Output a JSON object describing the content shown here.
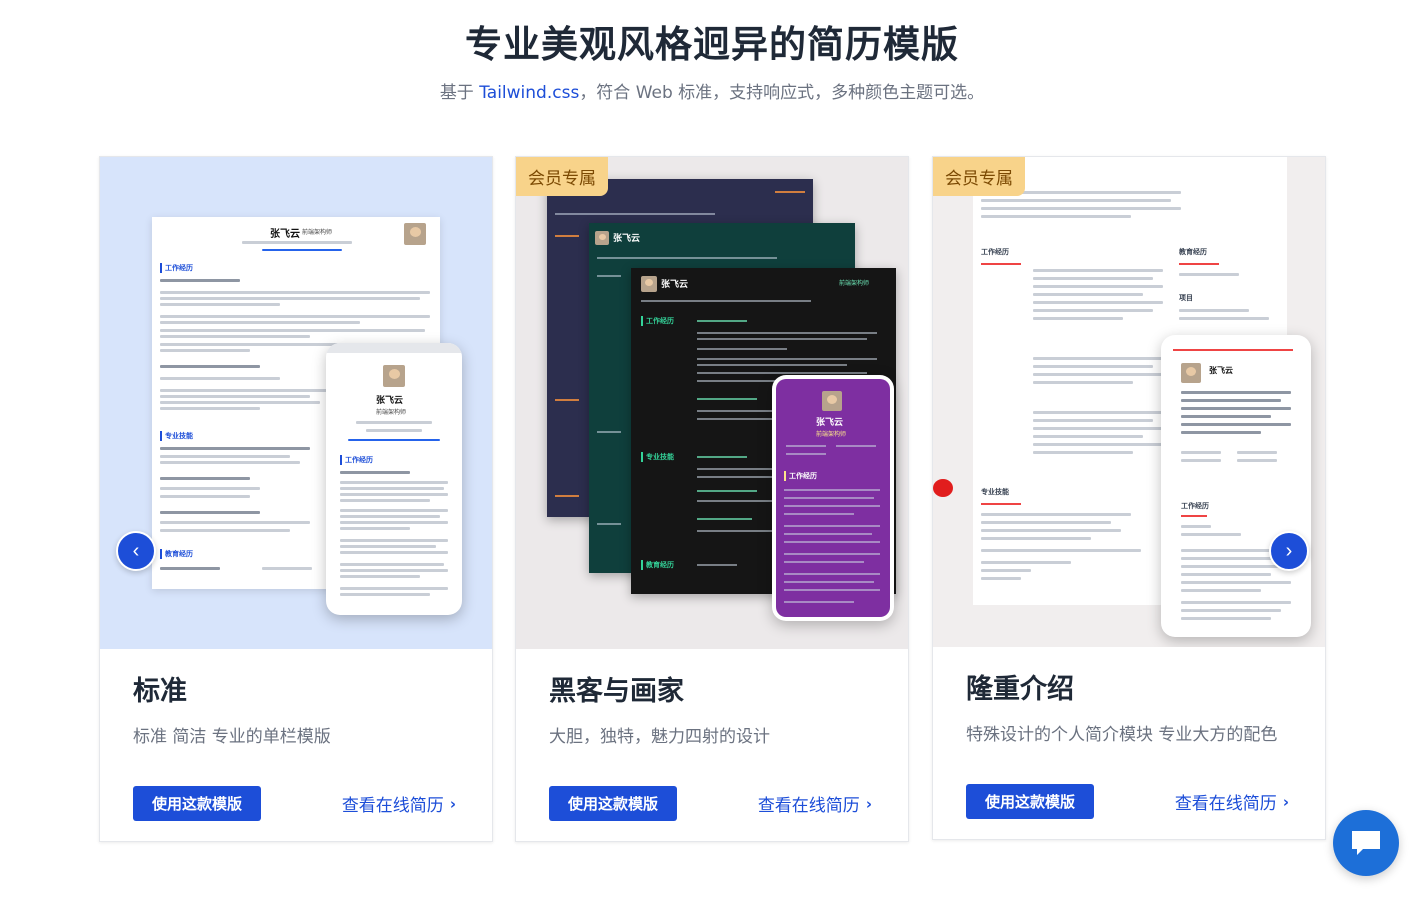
{
  "hero": {
    "title": "专业美观风格迥异的简历模版",
    "subtitle_prefix": "基于 ",
    "subtitle_link": "Tailwind.css",
    "subtitle_suffix": "，符合 Web 标准，支持响应式，多种颜色主题可选。"
  },
  "templates": [
    {
      "badge": "",
      "title": "标准",
      "description": "标准 简洁 专业的单栏模版",
      "use_label": "使用这款模版",
      "view_label": "查看在线简历",
      "preview": {
        "name": "张飞云",
        "role": "前端架构师",
        "phone_name": "张飞云",
        "phone_role": "前端架构师",
        "sections": [
          "工作经历",
          "专业技能",
          "教育经历"
        ],
        "phone_section": "工作经历"
      }
    },
    {
      "badge": "会员专属",
      "title": "黑客与画家",
      "description": "大胆，独特，魅力四射的设计",
      "use_label": "使用这款模版",
      "view_label": "查看在线简历",
      "preview": {
        "name_a": "张飞云",
        "name_b": "张飞云",
        "role": "前端架构师",
        "phone_name": "张飞云",
        "phone_role": "前端架构师",
        "phone_section": "工作经历",
        "sections_dark": [
          "工作经历",
          "专业技能",
          "教育经历"
        ]
      }
    },
    {
      "badge": "会员专属",
      "title": "隆重介绍",
      "description": "特殊设计的个人简介模块 专业大方的配色",
      "use_label": "使用这款模版",
      "view_label": "查看在线简历",
      "preview": {
        "sections": [
          "工作经历",
          "教育经历",
          "项目",
          "专业技能"
        ],
        "phone_name": "张飞云",
        "phone_section": "工作经历"
      }
    }
  ],
  "carousel": {
    "prev_icon": "chevron-left-icon",
    "next_icon": "chevron-right-icon",
    "prev_glyph": "‹",
    "next_glyph": "›"
  },
  "colors": {
    "accent": "#1d4ed8",
    "badge_bg": "#f8d38a",
    "standard_bg": "#d7e4fb"
  }
}
